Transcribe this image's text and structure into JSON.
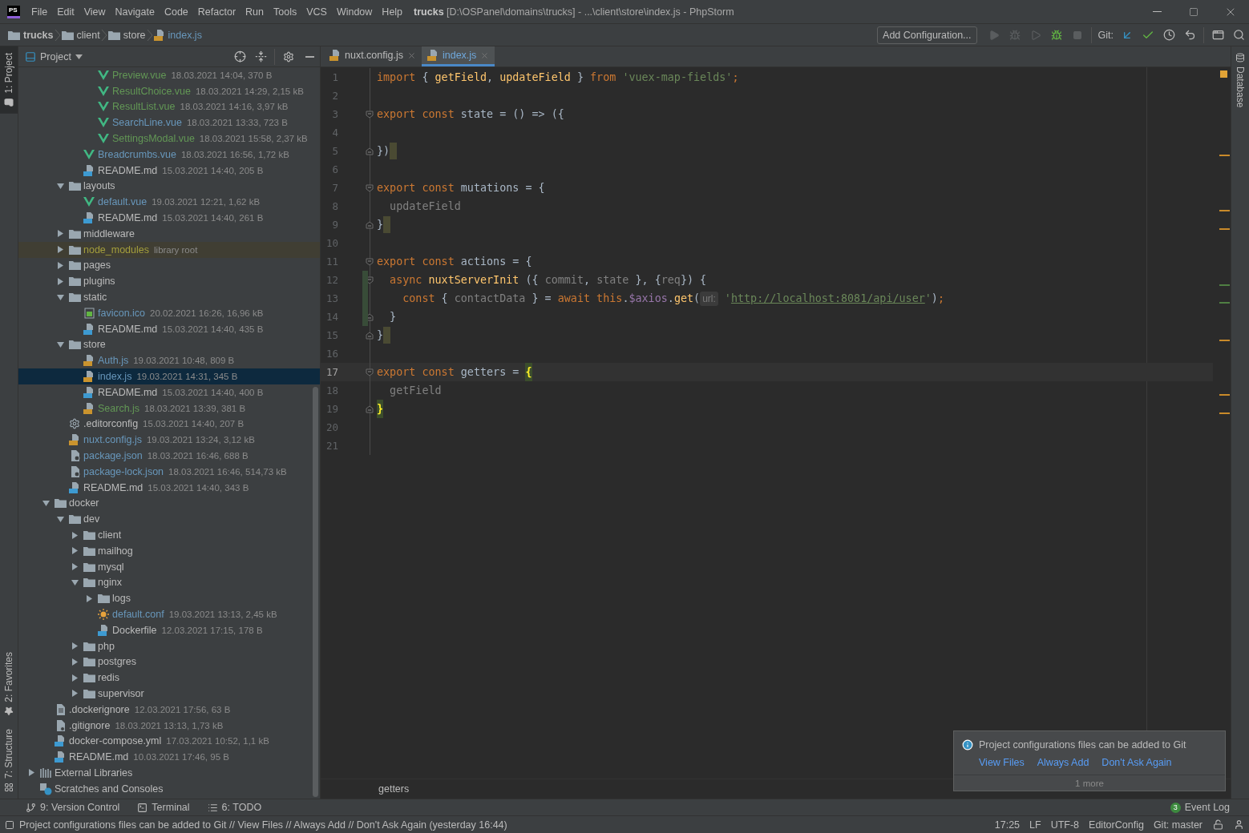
{
  "title_bar": {
    "logo": "PS",
    "menus": [
      "File",
      "Edit",
      "View",
      "Navigate",
      "Code",
      "Refactor",
      "Run",
      "Tools",
      "VCS",
      "Window",
      "Help"
    ],
    "title": "**trucks** [D:\\OSPanel\\domains\\trucks] - ...\\client\\store\\index.js - PhpStorm"
  },
  "nav_bar": {
    "breadcrumbs": [
      {
        "label": "trucks",
        "kind": "project"
      },
      {
        "label": "client",
        "kind": "folder"
      },
      {
        "label": "store",
        "kind": "folder"
      },
      {
        "label": "index.js",
        "kind": "js"
      }
    ],
    "run_config": "Add Configuration...",
    "git_label": "Git:"
  },
  "left_stripe": {
    "top": [
      {
        "label": "1: Project",
        "kind": "project",
        "selected": true
      }
    ],
    "bottom": [
      {
        "label": "2: Favorites",
        "kind": "favorites",
        "selected": false
      },
      {
        "label": "7: Structure",
        "kind": "structure",
        "selected": false
      }
    ]
  },
  "right_stripe": [
    {
      "label": "Database",
      "selected": false
    }
  ],
  "project_panel": {
    "title": "Project",
    "tree": [
      {
        "children": [
          {
            "children": [
              {
                "children": [
                  {
                    "children": [
                      {
                        "label": "Preview.vue",
                        "info": "18.03.2021 14:04, 370 B",
                        "kind": "vue",
                        "color": "#629755",
                        "selected": false
                      },
                      {
                        "label": "ResultChoice.vue",
                        "info": "18.03.2021 14:29, 2,15 kB",
                        "kind": "vue",
                        "color": "#629755",
                        "selected": false
                      },
                      {
                        "label": "ResultList.vue",
                        "info": "18.03.2021 14:16, 3,97 kB",
                        "kind": "vue",
                        "color": "#629755",
                        "selected": false
                      },
                      {
                        "label": "SearchLine.vue",
                        "info": "18.03.2021 13:33, 723 B",
                        "kind": "vue",
                        "color": "#6897bb",
                        "selected": false
                      },
                      {
                        "label": "SettingsModal.vue",
                        "info": "18.03.2021 15:58, 2,37 kB",
                        "kind": "vue",
                        "color": "#629755",
                        "selected": false
                      }
                    ]
                  },
                  {
                    "label": "Breadcrumbs.vue",
                    "info": "18.03.2021 16:56, 1,72 kB",
                    "kind": "vue",
                    "color": "#6897bb",
                    "selected": false
                  },
                  {
                    "label": "README.md",
                    "info": "15.03.2021 14:40, 205 B",
                    "kind": "md",
                    "color": "#bbbbbb",
                    "selected": false
                  }
                ]
              },
              {
                "label": "layouts",
                "kind": "folder",
                "color": "#bbbbbb",
                "expanded": true,
                "selected": false,
                "children": [
                  {
                    "label": "default.vue",
                    "info": "19.03.2021 12:21, 1,62 kB",
                    "kind": "vue",
                    "color": "#6897bb",
                    "selected": false
                  },
                  {
                    "label": "README.md",
                    "info": "15.03.2021 14:40, 261 B",
                    "kind": "md",
                    "color": "#bbbbbb",
                    "selected": false
                  }
                ]
              },
              {
                "label": "middleware",
                "kind": "folder",
                "color": "#bbbbbb",
                "expanded": false,
                "selected": false
              },
              {
                "label": "node_modules",
                "note": "library root",
                "library": true,
                "kind": "folder",
                "color": "#a39e3c",
                "expanded": false,
                "selected": false
              },
              {
                "label": "pages",
                "kind": "folder",
                "color": "#bbbbbb",
                "expanded": false,
                "selected": false
              },
              {
                "label": "plugins",
                "kind": "folder",
                "color": "#bbbbbb",
                "expanded": false,
                "selected": false
              },
              {
                "label": "static",
                "kind": "folder",
                "color": "#bbbbbb",
                "expanded": true,
                "selected": false,
                "children": [
                  {
                    "label": "favicon.ico",
                    "info": "20.02.2021 16:26, 16,96 kB",
                    "kind": "image",
                    "color": "#6897bb",
                    "selected": false
                  },
                  {
                    "label": "README.md",
                    "info": "15.03.2021 14:40, 435 B",
                    "kind": "md",
                    "color": "#bbbbbb",
                    "selected": false
                  }
                ]
              },
              {
                "label": "store",
                "kind": "folder",
                "color": "#bbbbbb",
                "expanded": true,
                "selected": false,
                "children": [
                  {
                    "label": "Auth.js",
                    "info": "19.03.2021 10:48, 809 B",
                    "kind": "js",
                    "color": "#6897bb",
                    "selected": false
                  },
                  {
                    "label": "index.js",
                    "info": "19.03.2021 14:31, 345 B",
                    "kind": "js",
                    "color": "#6897bb",
                    "selected": true
                  },
                  {
                    "label": "README.md",
                    "info": "15.03.2021 14:40, 400 B",
                    "kind": "md",
                    "color": "#bbbbbb",
                    "selected": false
                  },
                  {
                    "label": "Search.js",
                    "info": "18.03.2021 13:39, 381 B",
                    "kind": "js",
                    "color": "#629755",
                    "selected": false
                  }
                ]
              },
              {
                "label": ".editorconfig",
                "info": "15.03.2021 14:40, 207 B",
                "kind": "config",
                "color": "#bbbbbb",
                "selected": false
              },
              {
                "label": "nuxt.config.js",
                "info": "19.03.2021 13:24, 3,12 kB",
                "kind": "js",
                "color": "#6897bb",
                "selected": false
              },
              {
                "label": "package.json",
                "info": "18.03.2021 16:46, 688 B",
                "kind": "json",
                "color": "#6897bb",
                "selected": false
              },
              {
                "label": "package-lock.json",
                "info": "18.03.2021 16:46, 514,73 kB",
                "kind": "json",
                "color": "#6897bb",
                "selected": false
              },
              {
                "label": "README.md",
                "info": "15.03.2021 14:40, 343 B",
                "kind": "md",
                "color": "#bbbbbb",
                "selected": false
              }
            ]
          },
          {
            "label": "docker",
            "kind": "folder",
            "color": "#bbbbbb",
            "expanded": true,
            "selected": false,
            "children": [
              {
                "label": "dev",
                "kind": "folder",
                "color": "#bbbbbb",
                "expanded": true,
                "selected": false,
                "children": [
                  {
                    "label": "client",
                    "kind": "folder",
                    "color": "#bbbbbb",
                    "expanded": false,
                    "selected": false
                  },
                  {
                    "label": "mailhog",
                    "kind": "folder",
                    "color": "#bbbbbb",
                    "expanded": false,
                    "selected": false
                  },
                  {
                    "label": "mysql",
                    "kind": "folder",
                    "color": "#bbbbbb",
                    "expanded": false,
                    "selected": false
                  },
                  {
                    "label": "nginx",
                    "kind": "folder",
                    "color": "#bbbbbb",
                    "expanded": true,
                    "selected": false,
                    "children": [
                      {
                        "label": "logs",
                        "kind": "folder",
                        "color": "#bbbbbb",
                        "expanded": false,
                        "selected": false
                      },
                      {
                        "label": "default.conf",
                        "info": "19.03.2021 13:13, 2,45 kB",
                        "kind": "nginx",
                        "color": "#6897bb",
                        "selected": false
                      },
                      {
                        "label": "Dockerfile",
                        "info": "12.03.2021 17:15, 178 B",
                        "kind": "docker",
                        "color": "#bbbbbb",
                        "selected": false
                      }
                    ]
                  },
                  {
                    "label": "php",
                    "kind": "folder",
                    "color": "#bbbbbb",
                    "expanded": false,
                    "selected": false
                  },
                  {
                    "label": "postgres",
                    "kind": "folder",
                    "color": "#bbbbbb",
                    "expanded": false,
                    "selected": false
                  },
                  {
                    "label": "redis",
                    "kind": "folder",
                    "color": "#bbbbbb",
                    "expanded": false,
                    "selected": false
                  },
                  {
                    "label": "supervisor",
                    "kind": "folder",
                    "color": "#bbbbbb",
                    "expanded": false,
                    "selected": false
                  }
                ]
              }
            ]
          },
          {
            "label": ".dockerignore",
            "info": "12.03.2021 17:56, 63 B",
            "kind": "text",
            "color": "#bbbbbb",
            "selected": false
          },
          {
            "label": ".gitignore",
            "info": "18.03.2021 13:13, 1,73 kB",
            "kind": "ignore",
            "color": "#bbbbbb",
            "selected": false
          },
          {
            "label": "docker-compose.yml",
            "info": "17.03.2021 10:52, 1,1 kB",
            "kind": "yml",
            "color": "#bbbbbb",
            "selected": false
          },
          {
            "label": "README.md",
            "info": "10.03.2021 17:46, 95 B",
            "kind": "md",
            "color": "#bbbbbb",
            "selected": false
          }
        ]
      },
      {
        "label": "External Libraries",
        "kind": "libraries",
        "color": "#bbbbbb",
        "expanded": false,
        "selected": false
      },
      {
        "label": "Scratches and Consoles",
        "kind": "scratches",
        "color": "#bbbbbb",
        "selected": false
      }
    ]
  },
  "editor": {
    "tabs": [
      {
        "label": "nuxt.config.js",
        "selected": false
      },
      {
        "label": "index.js",
        "selected": true
      }
    ],
    "lines": [
      {
        "n": "1",
        "current": false,
        "changed": false,
        "marker": false,
        "fold_start": false,
        "fold_end": false,
        "tokens": [
          {
            "kind": "kw",
            "text": "import"
          },
          {
            "kind": "p",
            "text": " { "
          },
          {
            "kind": "fn",
            "text": "getField"
          },
          {
            "kind": "p",
            "text": ", "
          },
          {
            "kind": "fn",
            "text": "updateField"
          },
          {
            "kind": "p",
            "text": " } "
          },
          {
            "kind": "kw",
            "text": "from "
          },
          {
            "kind": "str",
            "text": "'vuex-map-fields'"
          },
          {
            "kind": "kw",
            "text": ";"
          }
        ]
      },
      {
        "n": "2",
        "current": false,
        "changed": false,
        "marker": false,
        "fold_start": false,
        "fold_end": false
      },
      {
        "n": "3",
        "current": false,
        "changed": false,
        "marker": false,
        "fold_start": true,
        "fold_end": false,
        "tokens": [
          {
            "kind": "kw",
            "text": "export const"
          },
          {
            "kind": "p",
            "text": " state = () => ({"
          }
        ]
      },
      {
        "n": "4",
        "current": false,
        "changed": false,
        "marker": false,
        "fold_start": false,
        "fold_end": false
      },
      {
        "n": "5",
        "current": false,
        "changed": false,
        "marker": true,
        "fold_start": false,
        "fold_end": true,
        "tokens": [
          {
            "kind": "p",
            "text": "})"
          }
        ]
      },
      {
        "n": "6",
        "current": false,
        "changed": false,
        "marker": false,
        "fold_start": false,
        "fold_end": false
      },
      {
        "n": "7",
        "current": false,
        "changed": false,
        "marker": false,
        "fold_start": true,
        "fold_end": false,
        "tokens": [
          {
            "kind": "kw",
            "text": "export const"
          },
          {
            "kind": "p",
            "text": " mutations = {"
          }
        ]
      },
      {
        "n": "8",
        "current": false,
        "changed": false,
        "marker": false,
        "fold_start": false,
        "fold_end": false,
        "tokens": [
          {
            "kind": "gray",
            "text": "  updateField"
          }
        ]
      },
      {
        "n": "9",
        "current": false,
        "changed": false,
        "marker": true,
        "fold_start": false,
        "fold_end": true,
        "tokens": [
          {
            "kind": "p",
            "text": "}"
          }
        ]
      },
      {
        "n": "10",
        "current": false,
        "changed": false,
        "marker": false,
        "fold_start": false,
        "fold_end": false
      },
      {
        "n": "11",
        "current": false,
        "changed": false,
        "marker": false,
        "fold_start": true,
        "fold_end": false,
        "tokens": [
          {
            "kind": "kw",
            "text": "export const"
          },
          {
            "kind": "p",
            "text": " actions = {"
          }
        ]
      },
      {
        "n": "12",
        "current": false,
        "changed": true,
        "marker": false,
        "fold_start": true,
        "fold_end": false,
        "tokens": [
          {
            "kind": "kw",
            "text": "  async "
          },
          {
            "kind": "fn",
            "text": "nuxtServerInit"
          },
          {
            "kind": "p",
            "text": " ({ "
          },
          {
            "kind": "gray",
            "text": "commit"
          },
          {
            "kind": "p",
            "text": ", "
          },
          {
            "kind": "gray",
            "text": "state"
          },
          {
            "kind": "p",
            "text": " }, {"
          },
          {
            "kind": "gray",
            "text": "req"
          },
          {
            "kind": "p",
            "text": "}) {"
          }
        ]
      },
      {
        "n": "13",
        "current": false,
        "changed": true,
        "marker": false,
        "fold_start": false,
        "fold_end": false,
        "tokens": [
          {
            "kind": "kw",
            "text": "    const"
          },
          {
            "kind": "p",
            "text": " { "
          },
          {
            "kind": "gray",
            "text": "contactData"
          },
          {
            "kind": "p",
            "text": " } = "
          },
          {
            "kind": "kw",
            "text": "await this"
          },
          {
            "kind": "p",
            "text": "."
          },
          {
            "kind": "prop",
            "text": "$axios"
          },
          {
            "kind": "p",
            "text": "."
          },
          {
            "kind": "fn",
            "text": "get"
          },
          {
            "kind": "p",
            "text": "("
          },
          {
            "kind": "hint",
            "text": "url:"
          },
          {
            "kind": "str",
            "text": " '"
          },
          {
            "kind": "url",
            "text": "http://localhost:8081/api/user"
          },
          {
            "kind": "str",
            "text": "'"
          },
          {
            "kind": "p",
            "text": ")"
          },
          {
            "kind": "kw",
            "text": ";"
          }
        ]
      },
      {
        "n": "14",
        "current": false,
        "changed": true,
        "marker": false,
        "fold_start": false,
        "fold_end": true,
        "tokens": [
          {
            "kind": "p",
            "text": "  }"
          }
        ]
      },
      {
        "n": "15",
        "current": false,
        "changed": false,
        "marker": true,
        "fold_start": false,
        "fold_end": true,
        "tokens": [
          {
            "kind": "p",
            "text": "}"
          }
        ]
      },
      {
        "n": "16",
        "current": false,
        "changed": false,
        "marker": false,
        "fold_start": false,
        "fold_end": false
      },
      {
        "n": "17",
        "current": true,
        "changed": false,
        "marker": false,
        "fold_start": true,
        "fold_end": false,
        "tokens": [
          {
            "kind": "kw",
            "text": "export const"
          },
          {
            "kind": "p",
            "text": " getters = "
          },
          {
            "kind": "match",
            "text": "{"
          }
        ]
      },
      {
        "n": "18",
        "current": false,
        "changed": false,
        "marker": false,
        "fold_start": false,
        "fold_end": false,
        "tokens": [
          {
            "kind": "gray",
            "text": "  getField"
          }
        ]
      },
      {
        "n": "19",
        "current": false,
        "changed": false,
        "marker": false,
        "fold_start": false,
        "fold_end": true,
        "tokens": [
          {
            "kind": "match",
            "text": "}"
          }
        ]
      },
      {
        "n": "20",
        "current": false,
        "changed": false,
        "marker": false,
        "fold_start": false,
        "fold_end": false
      },
      {
        "n": "21",
        "current": false,
        "changed": false,
        "marker": false,
        "fold_start": false,
        "fold_end": false
      }
    ],
    "breadcrumb": "getters"
  },
  "notification": {
    "message": "Project configurations files can be added to Git",
    "actions": [
      "View Files",
      "Always Add",
      "Don't Ask Again"
    ],
    "more": "1 more"
  },
  "tool_windows": [
    {
      "label": "9: Version Control",
      "kind": "vcs"
    },
    {
      "label": "Terminal",
      "kind": "terminal"
    },
    {
      "label": "6: TODO",
      "kind": "todo"
    }
  ],
  "event_log": {
    "count": "3",
    "label": "Event Log"
  },
  "status_bar": {
    "message": "Project configurations files can be added to Git // View Files // Always Add // Don't Ask Again (yesterday 16:44)",
    "items": [
      "17:25",
      "LF",
      "UTF-8",
      "EditorConfig",
      "Git: master"
    ]
  }
}
